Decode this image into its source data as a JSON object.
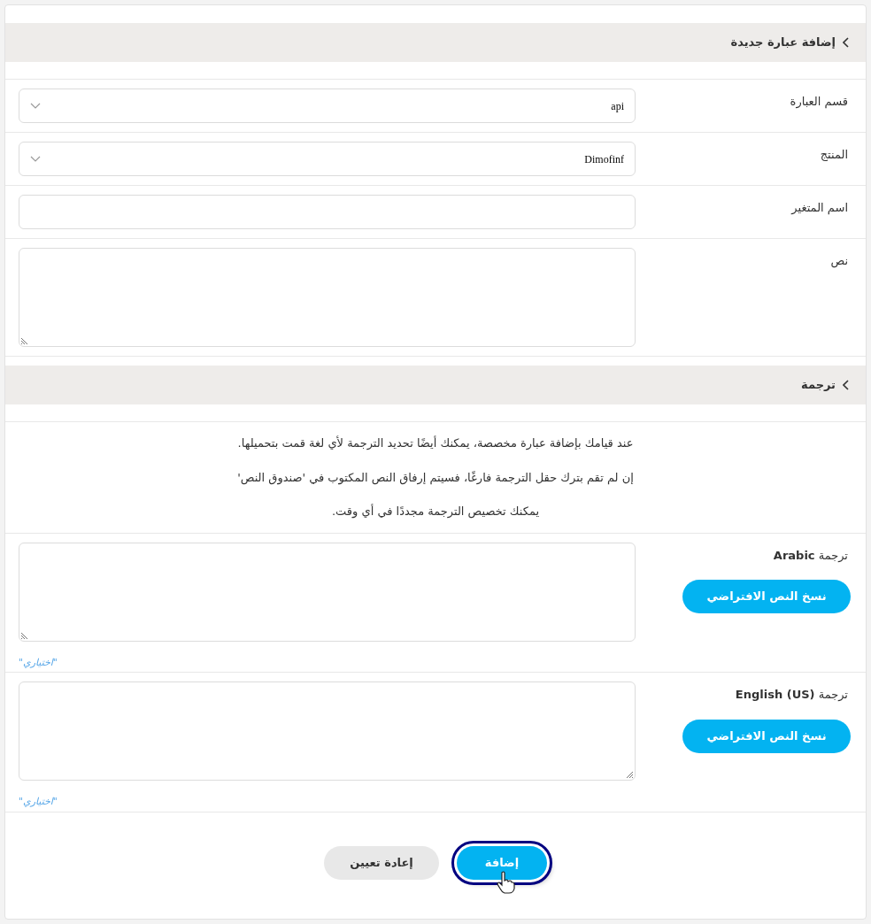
{
  "sections": [
    {
      "title": "إضافة عبارة جديدة",
      "expanded": true
    },
    {
      "title": "ترجمة",
      "expanded": true
    }
  ],
  "fields": [
    {
      "kind": "select",
      "label": "قسم العبارة",
      "value": "api"
    },
    {
      "kind": "select",
      "label": "المنتج",
      "value": "Dimofinf"
    },
    {
      "kind": "input",
      "label": "اسم المتغير"
    },
    {
      "kind": "textarea",
      "label": "نص"
    }
  ],
  "notes": [
    "عند قيامك بإضافة عبارة مخصصة، يمكنك أيضًا تحديد الترجمة لأي لغة قمت بتحميلها.",
    "إن لم تقم بترك حقل الترجمة فارغًا، فسيتم إرفاق النص المكتوب في 'صندوق النص'",
    "يمكنك تخصيص الترجمة مجددًا في أي وقت."
  ],
  "translations": [
    {
      "label": "ترجمة **Arabic**",
      "button": "نسخ النص الافتراضي",
      "hint": "\"اختياري\""
    },
    {
      "label": "ترجمة **English (US)**",
      "button": "نسخ النص الافتراضي",
      "hint": "\"اختياري\""
    }
  ],
  "actions": [
    {
      "label": "إضافة",
      "kind": "primary",
      "focused": true
    },
    {
      "label": "إعادة تعيين",
      "kind": "secondary",
      "focused": false
    }
  ]
}
